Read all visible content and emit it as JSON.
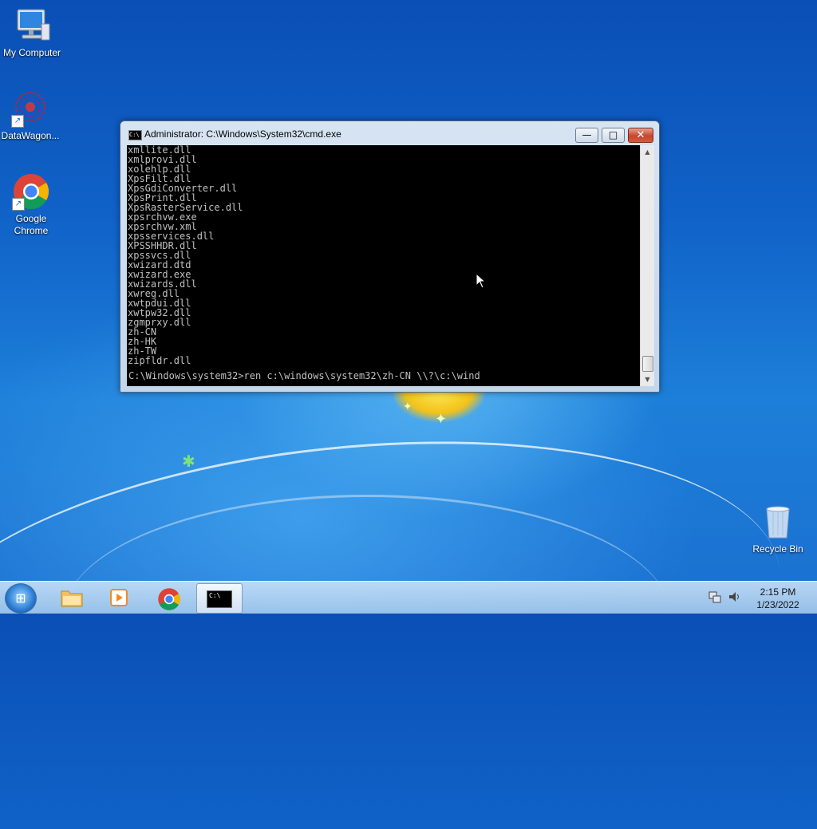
{
  "desktop": {
    "icons": [
      {
        "label": "My Computer",
        "icon": "computer-icon"
      },
      {
        "label": "DataWagon...",
        "icon": "datawagon-icon"
      },
      {
        "label": "Google Chrome",
        "icon": "chrome-icon"
      },
      {
        "label": "Recycle Bin",
        "icon": "recycle-bin-icon"
      }
    ]
  },
  "window": {
    "title": "Administrator: C:\\Windows\\System32\\cmd.exe",
    "icon_text": "C:\\",
    "controls": {
      "minimize": "—",
      "maximize": "□",
      "close": "✕"
    },
    "console_lines": [
      "xmllite.dll",
      "xmlprovi.dll",
      "xolehlp.dll",
      "XpsFilt.dll",
      "XpsGdiConverter.dll",
      "XpsPrint.dll",
      "XpsRasterService.dll",
      "xpsrchvw.exe",
      "xpsrchvw.xml",
      "xpsservices.dll",
      "XPSSHHDR.dll",
      "xpssvcs.dll",
      "xwizard.dtd",
      "xwizard.exe",
      "xwizards.dll",
      "xwreg.dll",
      "xwtpdui.dll",
      "xwtpw32.dll",
      "zgmprxy.dll",
      "zh-CN",
      "zh-HK",
      "zh-TW",
      "zipfldr.dll"
    ],
    "prompt_line": "C:\\Windows\\system32>ren c:\\windows\\system32\\zh-CN \\\\?\\c:\\wind"
  },
  "taskbar": {
    "start_label": "start",
    "pinned": [
      {
        "name": "explorer",
        "icon": "folder-icon"
      },
      {
        "name": "media-player",
        "icon": "media-player-icon"
      },
      {
        "name": "chrome",
        "icon": "chrome-icon"
      },
      {
        "name": "cmd",
        "icon": "cmd-icon",
        "active": true
      }
    ],
    "cmd_icon_text": "C:\\",
    "time": "2:15 PM",
    "date": "1/23/2022"
  }
}
